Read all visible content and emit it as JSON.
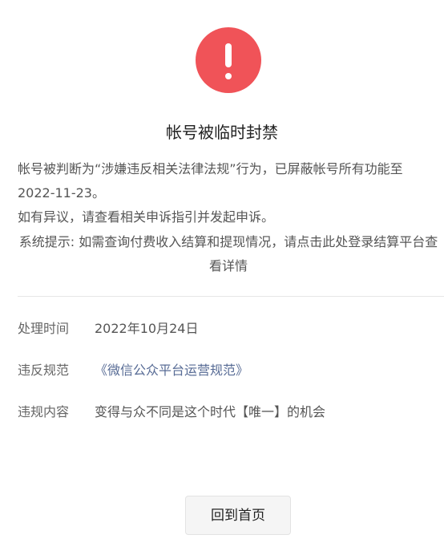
{
  "status": {
    "icon": "exclamation-circle-icon",
    "color": "#f05358"
  },
  "title": "帐号被临时封禁",
  "description": {
    "line1": "帐号被判断为“涉嫌违反相关法律法规”行为，已屏蔽帐号所有功能至2022-11-23。",
    "line2": "如有异议，请查看相关申诉指引并发起申诉。"
  },
  "notice": "系统提示: 如需查询付费收入结算和提现情况，请点击此处登录结算平台查看详情",
  "details": [
    {
      "label": "处理时间",
      "value": "2022年10月24日"
    },
    {
      "label": "违反规范",
      "value": "《微信公众平台运营规范》"
    },
    {
      "label": "违规内容",
      "value": "变得与众不同是这个时代【唯一】的机会"
    }
  ],
  "actions": {
    "home_label": "回到首页"
  },
  "colors": {
    "link": "#576b95",
    "button_bg": "#f5f5f5"
  }
}
